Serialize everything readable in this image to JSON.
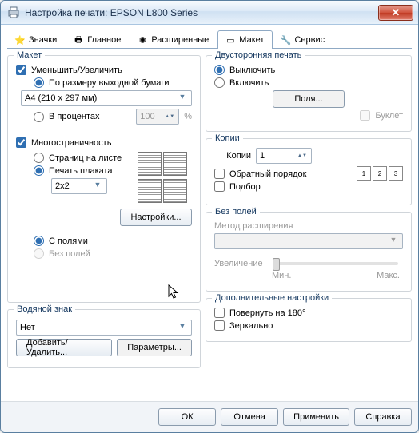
{
  "window": {
    "title": "Настройка печати: EPSON L800 Series"
  },
  "tabs": [
    {
      "id": "icons",
      "label": "Значки"
    },
    {
      "id": "main",
      "label": "Главное"
    },
    {
      "id": "advanced",
      "label": "Расширенные"
    },
    {
      "id": "layout",
      "label": "Макет"
    },
    {
      "id": "service",
      "label": "Сервис"
    }
  ],
  "layout": {
    "group_label": "Макет",
    "reduce_enlarge": "Уменьшить/Увеличить",
    "by_output": "По размеру выходной бумаги",
    "paper": "A4 (210 x 297 мм)",
    "by_percent": "В процентах",
    "percent_value": "100",
    "percent_suffix": "%",
    "multipage": "Многостраничность",
    "pages_per_sheet": "Страниц на листе",
    "poster": "Печать плаката",
    "poster_size": "2x2",
    "settings_btn": "Настройки...",
    "with_margins": "С полями",
    "without_margins": "Без полей"
  },
  "watermark": {
    "group_label": "Водяной знак",
    "value": "Нет",
    "add_remove": "Добавить/Удалить...",
    "params": "Параметры..."
  },
  "duplex": {
    "group_label": "Двусторонняя печать",
    "off": "Выключить",
    "on": "Включить",
    "margins_btn": "Поля...",
    "booklet": "Буклет"
  },
  "copies": {
    "group_label": "Копии",
    "copies_label": "Копии",
    "copies_value": "1",
    "reverse": "Обратный порядок",
    "collate": "Подбор"
  },
  "borderless": {
    "group_label": "Без полей",
    "method_label": "Метод расширения",
    "enlarge": "Увеличение",
    "min": "Мин.",
    "max": "Макс."
  },
  "more": {
    "group_label": "Дополнительные настройки",
    "rotate": "Повернуть на  180°",
    "mirror": "Зеркально"
  },
  "footer": {
    "ok": "ОК",
    "cancel": "Отмена",
    "apply": "Применить",
    "help": "Справка"
  }
}
